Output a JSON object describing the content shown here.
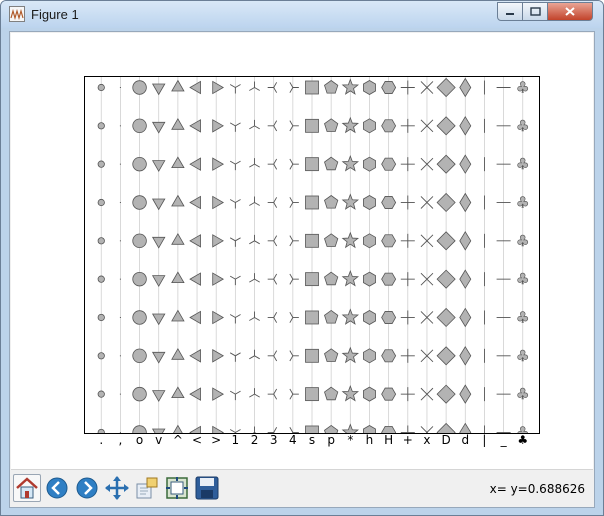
{
  "window": {
    "title": "Figure 1"
  },
  "toolbar": {
    "buttons": [
      {
        "name": "home-icon",
        "label": "Home"
      },
      {
        "name": "back-icon",
        "label": "Back"
      },
      {
        "name": "forward-icon",
        "label": "Forward"
      },
      {
        "name": "pan-icon",
        "label": "Pan"
      },
      {
        "name": "zoom-icon",
        "label": "Zoom"
      },
      {
        "name": "subplots-icon",
        "label": "Configure subplots"
      },
      {
        "name": "save-icon",
        "label": "Save"
      }
    ]
  },
  "status": {
    "text": "x= y=0.688626"
  },
  "chart_data": {
    "type": "scatter",
    "markers": [
      ".",
      ",",
      "o",
      "v",
      "^",
      "<",
      ">",
      "1",
      "2",
      "3",
      "4",
      "s",
      "p",
      "*",
      "h",
      "H",
      "+",
      "x",
      "D",
      "d",
      "|",
      "_",
      "♣"
    ],
    "xticklabels": [
      ".",
      ",",
      "o",
      "v",
      "^",
      "<",
      ">",
      "1",
      "2",
      "3",
      "4",
      "s",
      "p",
      "*",
      "h",
      "H",
      "+",
      "x",
      "D",
      "d",
      "|",
      "_",
      "♣"
    ],
    "x": [
      1,
      2,
      3,
      4,
      5,
      6,
      7,
      8,
      9,
      10,
      11,
      12,
      13,
      14,
      15,
      16,
      17,
      18,
      19,
      20,
      21,
      22,
      23
    ],
    "y": [
      1,
      2,
      3,
      4,
      5,
      6,
      7,
      8,
      9,
      10,
      11
    ],
    "grid": "vertical",
    "colors": {
      "marker_fill": "#b3b3b3",
      "marker_edge": "#555555",
      "grid": "#d0d0d0"
    }
  }
}
